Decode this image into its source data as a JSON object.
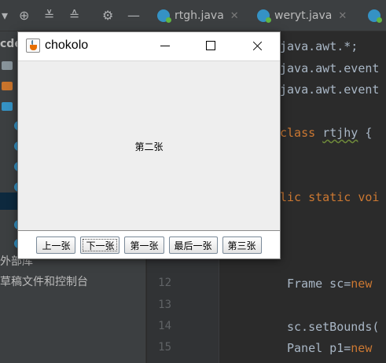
{
  "ide": {
    "project_header": "cde",
    "sidebar_labels": [
      "外部库",
      "草稿文件和控制台"
    ],
    "tabs": [
      {
        "label": "rtgh.java"
      },
      {
        "label": "weryt.java"
      }
    ],
    "line_numbers": [
      "12",
      "13",
      "14",
      "15"
    ],
    "code_lines": [
      "java.awt.*;",
      "java.awt.event",
      "java.awt.event",
      "class ",
      "rtjhy",
      " {",
      "lic static voi",
      "Frame sc=",
      "new",
      "sc.setBounds(",
      "Panel p1=",
      "new"
    ]
  },
  "window": {
    "title": "chokolo",
    "card_text": "第二张",
    "buttons": [
      {
        "label": "上一张"
      },
      {
        "label": "下一张"
      },
      {
        "label": "第一张"
      },
      {
        "label": "最后一张"
      },
      {
        "label": "第三张"
      }
    ]
  },
  "colors": {
    "ide_bg": "#2b2b2b",
    "keyword": "#cc7832",
    "panel_bg": "#eeeeee"
  }
}
